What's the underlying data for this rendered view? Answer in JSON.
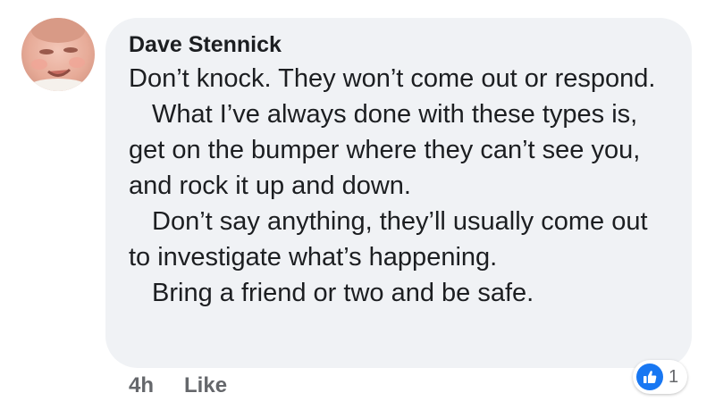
{
  "comment": {
    "author": "Dave Stennick",
    "paragraphs": [
      "Don’t knock. They won’t come out or respond.",
      "What I’ve always done with these types is, get on the bumper where they can’t see you, and rock it up and down.",
      "Don’t say anything, they’ll usually come out to investigate what’s happening.",
      "Bring a friend or two and be safe."
    ],
    "bubble_color": "#f0f2f5"
  },
  "actions": {
    "timestamp": "4h",
    "like_label": "Like"
  },
  "reactions": {
    "icon": "thumbs-up-icon",
    "count": "1",
    "color": "#1877f2"
  },
  "avatar": {
    "icon": "baby-face-avatar"
  }
}
